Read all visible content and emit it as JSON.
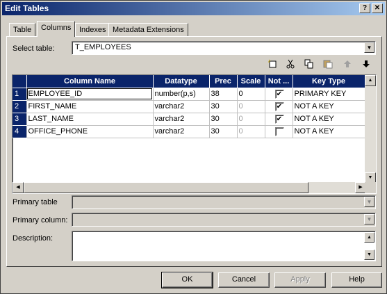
{
  "window": {
    "title": "Edit Tables"
  },
  "tabs": [
    {
      "label": "Table",
      "active": false
    },
    {
      "label": "Columns",
      "active": true
    },
    {
      "label": "Indexes",
      "active": false
    },
    {
      "label": "Metadata Extensions",
      "active": false
    }
  ],
  "select_table": {
    "label": "Select table:",
    "value": "T_EMPLOYEES"
  },
  "toolbar": {
    "icons": [
      "new-column-icon",
      "cut-icon",
      "copy-icon",
      "paste-icon",
      "move-up-icon",
      "move-down-icon"
    ]
  },
  "grid": {
    "columns": [
      "Column Name",
      "Datatype",
      "Prec",
      "Scale",
      "Not ...",
      "Key Type"
    ],
    "rows": [
      {
        "num": "1",
        "name": "EMPLOYEE_ID",
        "datatype": "number(p,s)",
        "prec": "38",
        "scale": "0",
        "not_null": true,
        "key": "PRIMARY KEY"
      },
      {
        "num": "2",
        "name": "FIRST_NAME",
        "datatype": "varchar2",
        "prec": "30",
        "scale": "0",
        "not_null": true,
        "key": "NOT A KEY"
      },
      {
        "num": "3",
        "name": "LAST_NAME",
        "datatype": "varchar2",
        "prec": "30",
        "scale": "0",
        "not_null": true,
        "key": "NOT A KEY"
      },
      {
        "num": "4",
        "name": "OFFICE_PHONE",
        "datatype": "varchar2",
        "prec": "30",
        "scale": "0",
        "not_null": false,
        "key": "NOT A KEY"
      }
    ]
  },
  "fields": {
    "primary_table": "Primary table",
    "primary_column": "Primary column:",
    "description": "Description:"
  },
  "buttons": {
    "ok": "OK",
    "cancel": "Cancel",
    "apply": "Apply",
    "help": "Help"
  },
  "colors": {
    "titlebar_start": "#0a246a",
    "titlebar_end": "#a6caf0",
    "header": "#0a246a",
    "face": "#d4d0c8"
  }
}
